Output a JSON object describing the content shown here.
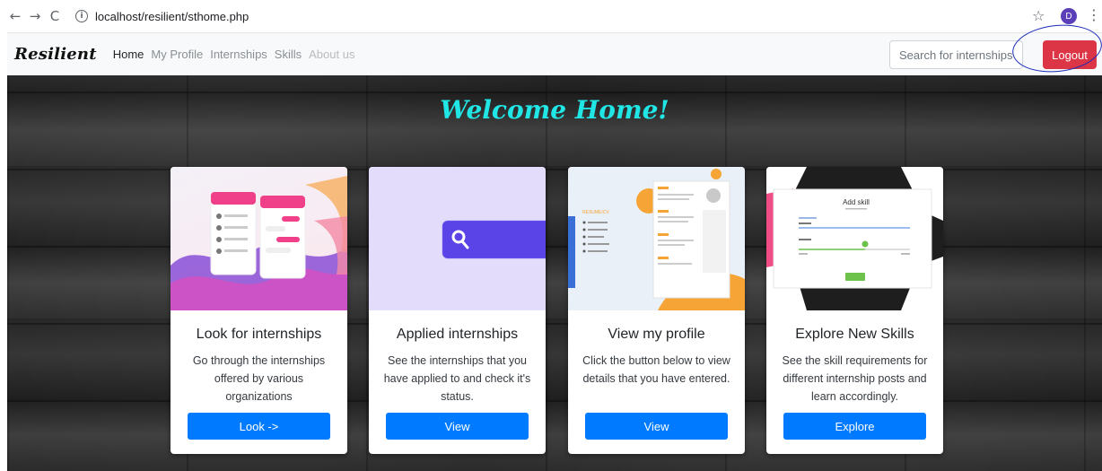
{
  "browser": {
    "url": "localhost/resilient/sthome.php",
    "profile_initial": "D",
    "back_glyph": "←",
    "forward_glyph": "→",
    "reload_glyph": "C",
    "info_glyph": "i",
    "star_glyph": "☆",
    "menu_glyph": "⋮"
  },
  "navbar": {
    "brand": "Resilient",
    "links": [
      "Home",
      "My Profile",
      "Internships",
      "Skills",
      "About us"
    ],
    "search_placeholder": "Search for internships",
    "logout_label": "Logout"
  },
  "hero": {
    "title": "Welcome Home!"
  },
  "cards": [
    {
      "title": "Look for internships",
      "text": "Go through the internships offered by various organizations",
      "button": "Look ->"
    },
    {
      "title": "Applied internships",
      "text": "See the internships that you have applied to and check it's status.",
      "button": "View"
    },
    {
      "title": "View my profile",
      "text": "Click the button below to view details that you have entered.",
      "button": "View"
    },
    {
      "title": "Explore New Skills",
      "text": "See the skill requirements for different internship posts and learn accordingly.",
      "button": "Explore"
    }
  ],
  "card_images": {
    "resume_label": "RESUME/CV",
    "add_skill_title": "Add skill"
  },
  "colors": {
    "logout": "#dc3545",
    "primary": "#007bff",
    "welcome": "#21e6e6",
    "annotation": "#1a2bb8"
  }
}
